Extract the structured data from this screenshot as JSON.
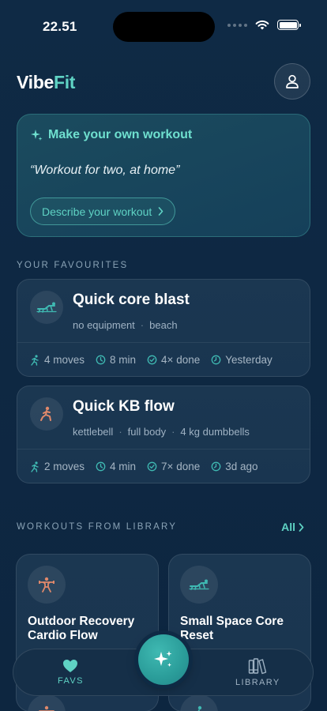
{
  "status_bar": {
    "time": "22.51"
  },
  "header": {
    "logo_part1": "Vibe",
    "logo_part2": "Fit"
  },
  "create_card": {
    "title": "Make your own workout",
    "quote": "“Workout for two, at home”",
    "button_label": "Describe your workout"
  },
  "favourites": {
    "section_label": "YOUR FAVOURITES",
    "items": [
      {
        "name": "Quick core blast",
        "tags": [
          "no equipment",
          "beach"
        ],
        "moves": "4 moves",
        "duration": "8 min",
        "done": "4× done",
        "last": "Yesterday",
        "icon": "core-exercise-icon"
      },
      {
        "name": "Quick KB flow",
        "tags": [
          "kettlebell",
          "full body",
          "4 kg dumbbells"
        ],
        "moves": "2 moves",
        "duration": "4 min",
        "done": "7× done",
        "last": "3d ago",
        "icon": "lunge-icon"
      }
    ]
  },
  "library": {
    "section_label": "WORKOUTS FROM LIBRARY",
    "all_label": "All",
    "items": [
      {
        "title": "Outdoor Recovery Cardio Flow",
        "icon": "weightlifter-icon"
      },
      {
        "title": "Small Space Core Reset",
        "icon": "core-exercise-icon"
      }
    ]
  },
  "bottom_nav": {
    "favs_label": "FAVS",
    "library_label": "LIBRARY"
  },
  "colors": {
    "accent": "#5fd3c4",
    "background": "#0f2a45",
    "card": "#1b3751",
    "orange_icon": "#e0896b"
  }
}
